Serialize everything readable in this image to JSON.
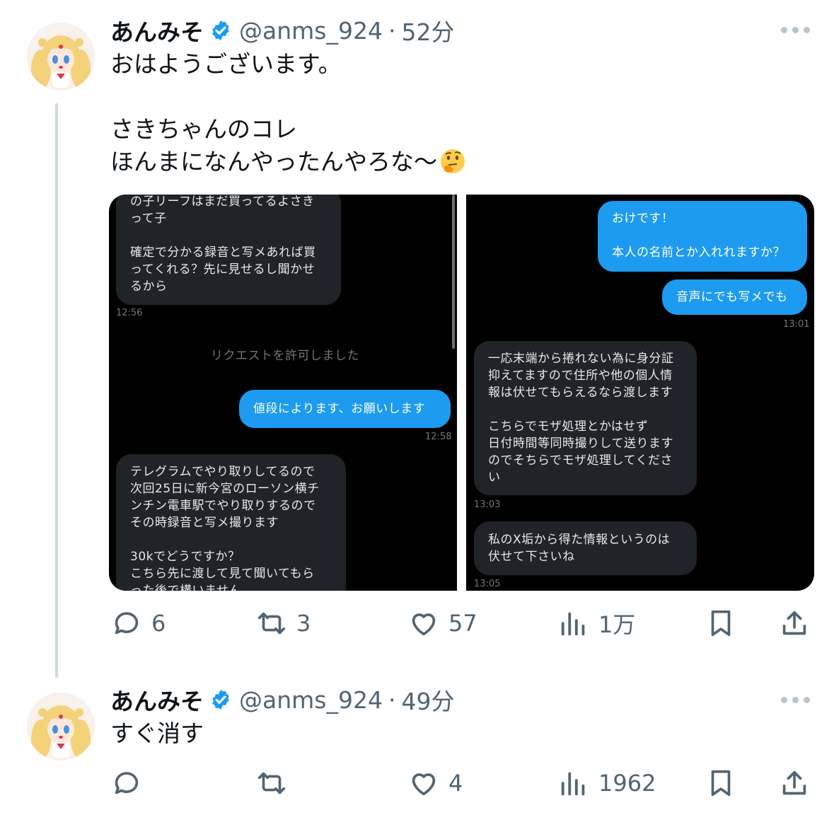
{
  "tweets": [
    {
      "display_name": "あんみそ",
      "handle": "@anms_924",
      "separator": "·",
      "time": "52分",
      "text": "おはようございます。\n\nさきちゃんのコレ\nほんまになんやったんやろな〜",
      "emoji": "thinking-face",
      "actions": {
        "replies": "6",
        "retweets": "3",
        "likes": "57",
        "views": "1万"
      },
      "media": {
        "left": {
          "msg1": "の子リーフはまだ買ってるよさき\nって子\n\n確定で分かる録音と写メあれば買\nってくれる？先に見せるし聞かせ\nるから",
          "time1": "12:56",
          "system": "リクエストを許可しました",
          "msg2": "値段によります、お願いします",
          "time2": "12:58",
          "msg3": "テレグラムでやり取りしてるので\n次回25日に新今宮のローソン横チ\nンチン電車駅でやり取りするので\nその時録音と写メ撮ります\n\n30kでどうですか？\nこちら先に渡して見て聞いてもら\nった後で構いません"
        },
        "right": {
          "msg1": "おけです！\n\n本人の名前とか入れれますか？",
          "msg2": "音声にでも写メでも",
          "time1": "13:01",
          "msg3": "一応末端から捲れない為に身分証\n抑えてますので住所や他の個人情\n報は伏せてもらえるなら渡します\n\nこちらでモザ処理とかはせず\n日付時間等同時撮りして送ります\nのでそちらでモザ処理してくださ\nい",
          "time2": "13:03",
          "msg4": "私のX垢から得た情報というのは\n伏せて下さいね",
          "time3": "13:05"
        }
      }
    },
    {
      "display_name": "あんみそ",
      "handle": "@anms_924",
      "separator": "·",
      "time": "49分",
      "text": "すぐ消す",
      "actions": {
        "replies": "",
        "retweets": "",
        "likes": "4",
        "views": "1962"
      }
    }
  ],
  "colors": {
    "verified": "#1d9bf0",
    "outgoing_bubble": "#1d9bf0",
    "incoming_bubble": "#202327",
    "muted": "#536471"
  }
}
